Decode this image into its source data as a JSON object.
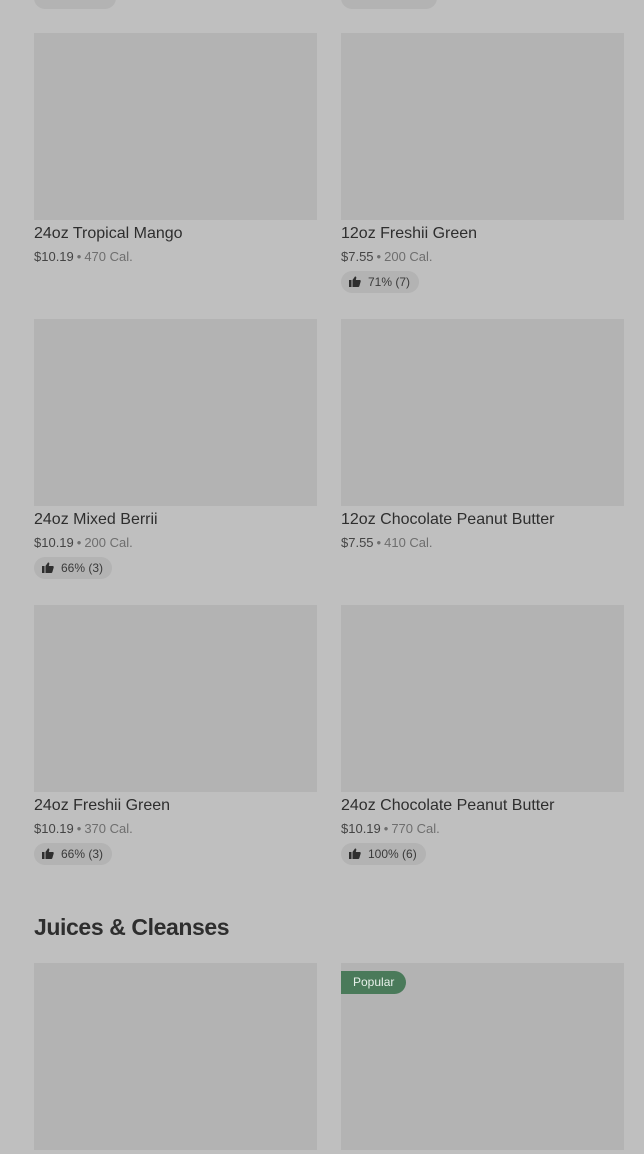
{
  "products": [
    {
      "name": "24oz Tropical Mango",
      "price": "$10.19",
      "calories": "470 Cal.",
      "rating": ""
    },
    {
      "name": "12oz Freshii Green",
      "price": "$7.55",
      "calories": "200 Cal.",
      "rating": "71% (7)"
    },
    {
      "name": "24oz Mixed Berrii",
      "price": "$10.19",
      "calories": "200 Cal.",
      "rating": "66% (3)"
    },
    {
      "name": "12oz Chocolate Peanut Butter",
      "price": "$7.55",
      "calories": "410 Cal.",
      "rating": ""
    },
    {
      "name": "24oz Freshii Green",
      "price": "$10.19",
      "calories": "370 Cal.",
      "rating": "66% (3)"
    },
    {
      "name": "24oz Chocolate Peanut Butter",
      "price": "$10.19",
      "calories": "770 Cal.",
      "rating": "100% (6)"
    }
  ],
  "separator": "•",
  "section": {
    "title": "Juices & Cleanses"
  },
  "juices": [
    {
      "badge": ""
    },
    {
      "badge": "Popular"
    }
  ],
  "icons": {
    "rating": "thumbs-up-icon"
  },
  "colors": {
    "background": "#bfbfbf",
    "placeholder": "#b3b3b3",
    "badge": "#4a7a5a"
  }
}
